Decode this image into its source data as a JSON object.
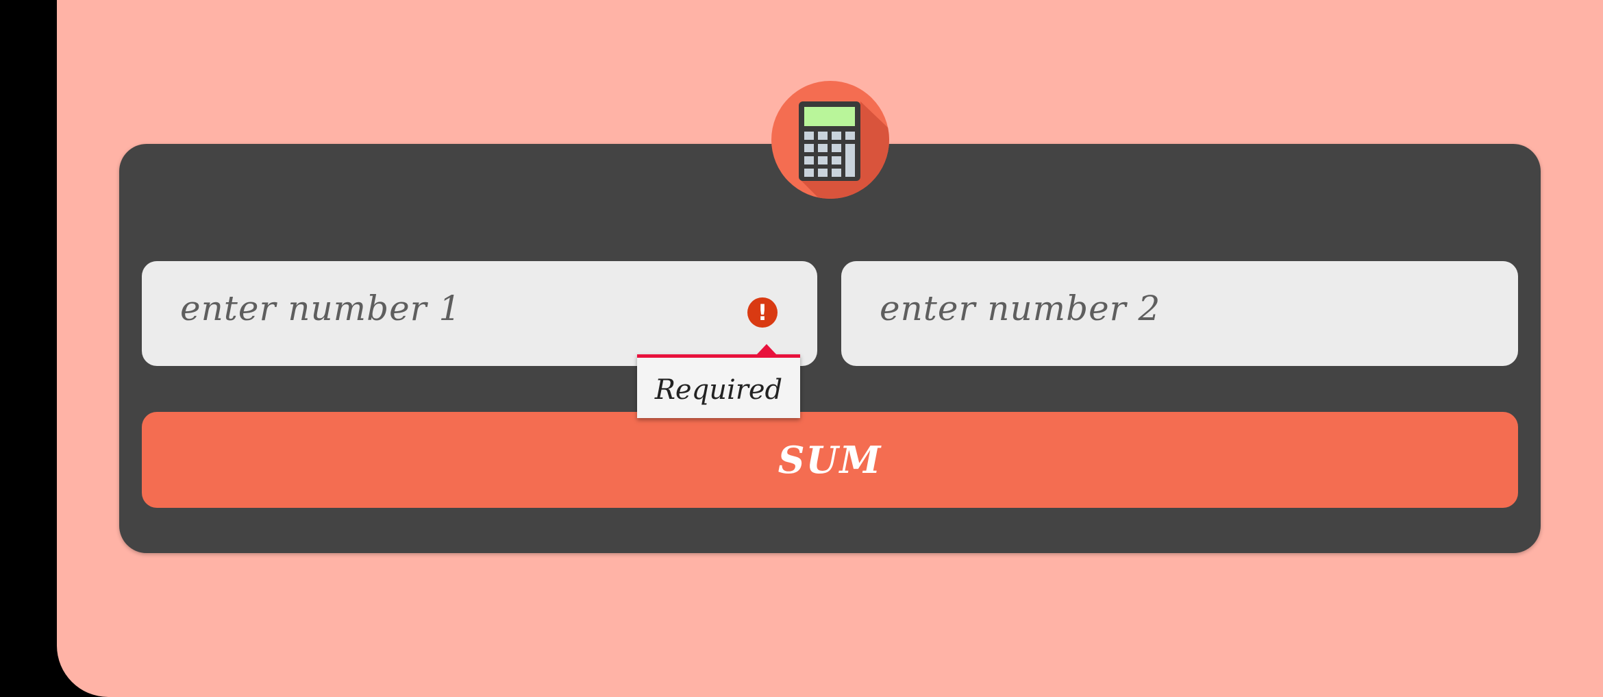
{
  "form": {
    "input1": {
      "placeholder": "enter number 1",
      "value": ""
    },
    "input2": {
      "placeholder": "enter number 2",
      "value": ""
    },
    "error_tooltip": "Required",
    "error_icon_glyph": "!",
    "sum_button_label": "SUM"
  },
  "icons": {
    "app": "calculator-icon",
    "error": "error-icon"
  },
  "colors": {
    "background": "#ffb3a6",
    "card": "#444444",
    "accent": "#f46d51",
    "input_bg": "#ececec",
    "error": "#d93a12",
    "tooltip_border": "#e8123c"
  }
}
